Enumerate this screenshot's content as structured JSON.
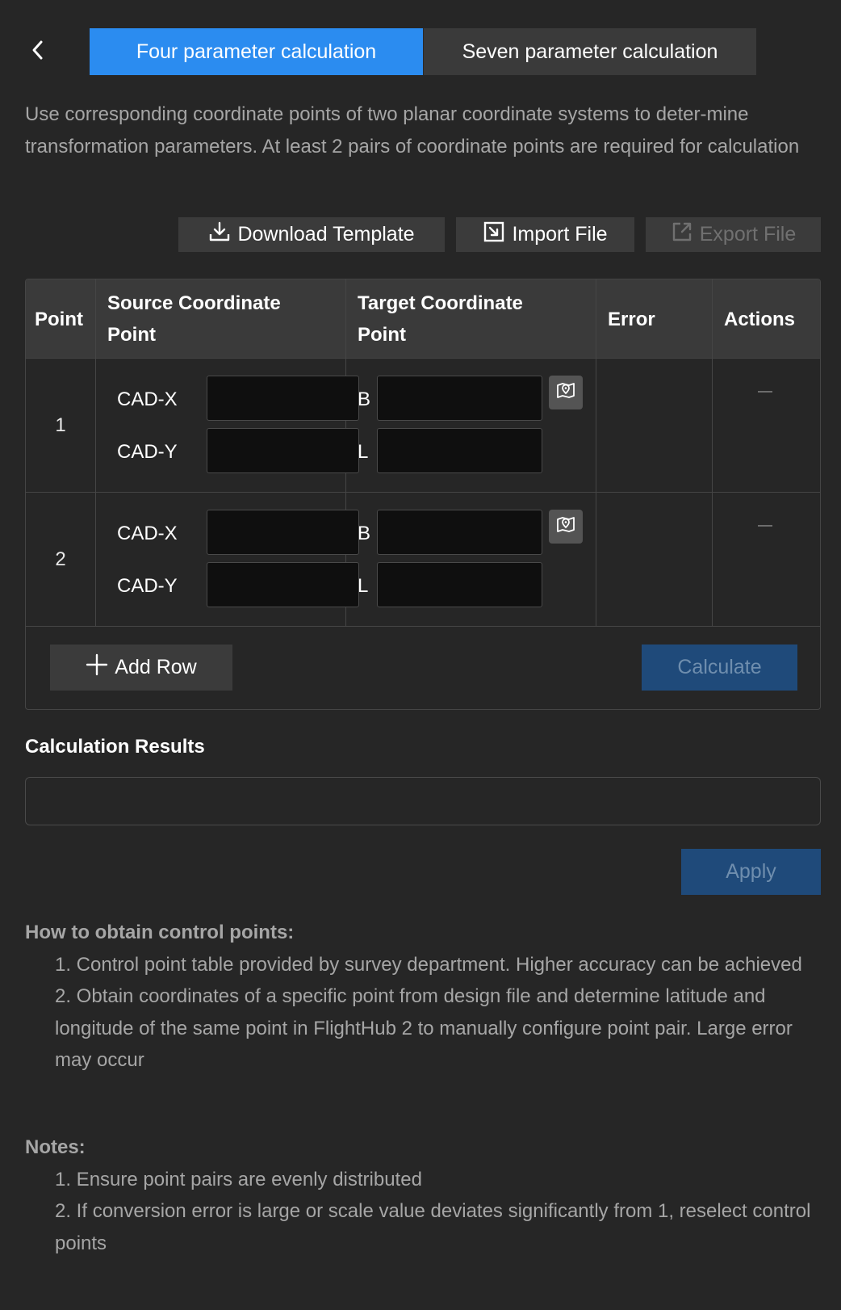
{
  "header": {
    "back_icon": "chevron-left-icon",
    "tabs": [
      {
        "label": "Four parameter calculation",
        "active": true
      },
      {
        "label": "Seven parameter calculation",
        "active": false
      }
    ]
  },
  "description": "Use corresponding coordinate points of two planar coordinate systems to deter-mine transformation parameters. At least 2 pairs of coordinate points are required for calculation",
  "toolbar": {
    "download_label": "Download Template",
    "import_label": "Import File",
    "export_label": "Export File"
  },
  "table": {
    "columns": [
      "Point",
      "Source Coordinate Point",
      "Target Coordinate Point",
      "Error",
      "Actions"
    ],
    "rows": [
      {
        "point": "1",
        "src_x_label": "CAD-X",
        "src_y_label": "CAD-Y",
        "tgt_b_label": "B",
        "tgt_l_label": "L",
        "src_x": "",
        "src_y": "",
        "tgt_b": "",
        "tgt_l": "",
        "error": ""
      },
      {
        "point": "2",
        "src_x_label": "CAD-X",
        "src_y_label": "CAD-Y",
        "tgt_b_label": "B",
        "tgt_l_label": "L",
        "src_x": "",
        "src_y": "",
        "tgt_b": "",
        "tgt_l": "",
        "error": ""
      }
    ],
    "add_row_label": "Add Row",
    "calculate_label": "Calculate"
  },
  "results": {
    "title": "Calculation Results",
    "value": "",
    "apply_label": "Apply"
  },
  "help": {
    "control_title": "How to obtain control points:",
    "control_items": [
      "1. Control point table provided by survey department. Higher accuracy can be achieved",
      "2. Obtain coordinates of a specific point from design file and determine latitude and longitude of the same point in FlightHub 2 to manually configure point pair. Large error may occur"
    ],
    "notes_title": "Notes:",
    "notes_items": [
      "1. Ensure point pairs are evenly distributed",
      "2. If conversion error is large or scale value deviates significantly from 1, reselect control points"
    ]
  },
  "colors": {
    "background": "#262626",
    "accent": "#2b8cf0",
    "disabled_primary": "#1f4a7a"
  }
}
